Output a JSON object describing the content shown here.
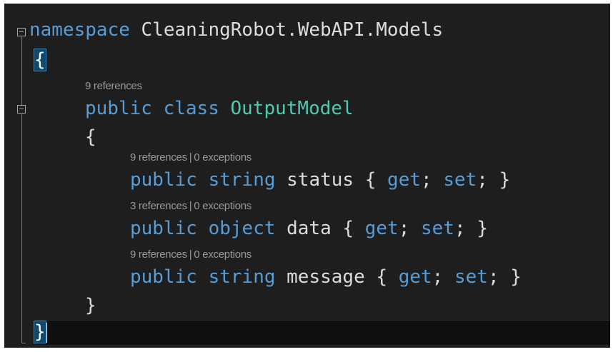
{
  "editor": {
    "lines": [
      {
        "keyword": "namespace",
        "name": "CleaningRobot.WebAPI.Models"
      },
      {
        "open_brace": "{"
      },
      {
        "codelens": {
          "references": "9 references"
        }
      },
      {
        "modifier": "public",
        "keyword": "class",
        "type_name": "OutputModel"
      },
      {
        "open_brace": "{"
      },
      {
        "codelens": {
          "references": "9 references",
          "separator": "|",
          "exceptions": "0 exceptions"
        }
      },
      {
        "modifier": "public",
        "type": "string",
        "name": "status",
        "accessor_open": "{",
        "get": "get",
        "semi": ";",
        "set": "set",
        "accessor_close": "}"
      },
      {
        "codelens": {
          "references": "3 references",
          "separator": "|",
          "exceptions": "0 exceptions"
        }
      },
      {
        "modifier": "public",
        "type": "object",
        "name": "data",
        "accessor_open": "{",
        "get": "get",
        "semi": ";",
        "set": "set",
        "accessor_close": "}"
      },
      {
        "codelens": {
          "references": "9 references",
          "separator": "|",
          "exceptions": "0 exceptions"
        }
      },
      {
        "modifier": "public",
        "type": "string",
        "name": "message",
        "accessor_open": "{",
        "get": "get",
        "semi": ";",
        "set": "set",
        "accessor_close": "}"
      },
      {
        "close_brace": "}"
      },
      {
        "close_brace": "}"
      }
    ]
  },
  "colors": {
    "background": "#1e1e1e",
    "keyword": "#569cd6",
    "type_name": "#4ec9b0",
    "identifier": "#dcdcdc",
    "codelens": "#999999",
    "brace_highlight": "#0e4a6f"
  },
  "icons": [
    "collapse-icon"
  ]
}
